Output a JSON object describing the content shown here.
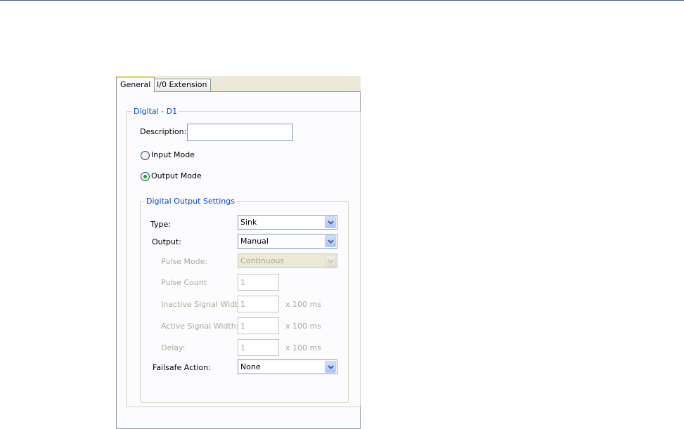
{
  "tabs": [
    {
      "label": "General",
      "active": true
    },
    {
      "label": "I/0 Extension",
      "active": false
    }
  ],
  "digital_group": {
    "title": "Digital - D1",
    "description_label": "Description:",
    "description_value": "",
    "input_mode_label": "Input Mode",
    "output_mode_label": "Output Mode",
    "selected_mode": "Output Mode"
  },
  "output_settings": {
    "title": "Digital Output Settings",
    "type_label": "Type:",
    "type_value": "Sink",
    "output_label": "Output:",
    "output_value": "Manual",
    "pulse_mode_label": "Pulse Mode:",
    "pulse_mode_value": "Continuous",
    "pulse_count_label": "Pulse Count",
    "pulse_count_value": "1",
    "inactive_width_label": "Inactive Signal Width:",
    "inactive_width_value": "1",
    "active_width_label": "Active Signal Width:",
    "active_width_value": "1",
    "delay_label": "Delay:",
    "delay_value": "1",
    "unit_label": "x 100 ms",
    "failsafe_label": "Failsafe Action:",
    "failsafe_value": "None"
  },
  "colors": {
    "group_title": "#0046d5",
    "disabled_text": "#aca899",
    "radio_dot": "#21a121"
  }
}
